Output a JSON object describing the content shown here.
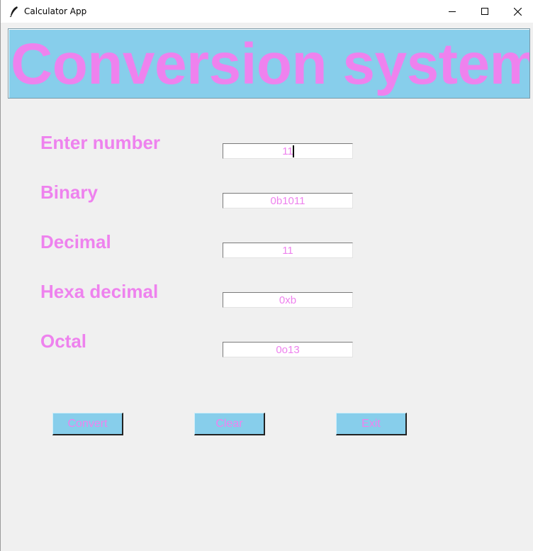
{
  "window": {
    "title": "Calculator App",
    "icon": "feather-icon",
    "controls": {
      "minimize": "minimize-icon",
      "maximize": "maximize-icon",
      "close": "close-icon"
    }
  },
  "banner": {
    "text": "Conversion system"
  },
  "colors": {
    "accent_text": "#ee82ee",
    "banner_bg": "#87ceeb",
    "button_bg": "#87ceeb",
    "window_bg": "#f0f0f0"
  },
  "form": {
    "enter_number": {
      "label": "Enter number",
      "value": "11"
    },
    "binary": {
      "label": "Binary",
      "value": "0b1011"
    },
    "decimal": {
      "label": "Decimal",
      "value": "11"
    },
    "hexadecimal": {
      "label": "Hexa decimal",
      "value": "0xb"
    },
    "octal": {
      "label": "Octal",
      "value": "0o13"
    }
  },
  "buttons": {
    "convert": "Convert",
    "clear": "Clear",
    "exit": "Exit"
  }
}
